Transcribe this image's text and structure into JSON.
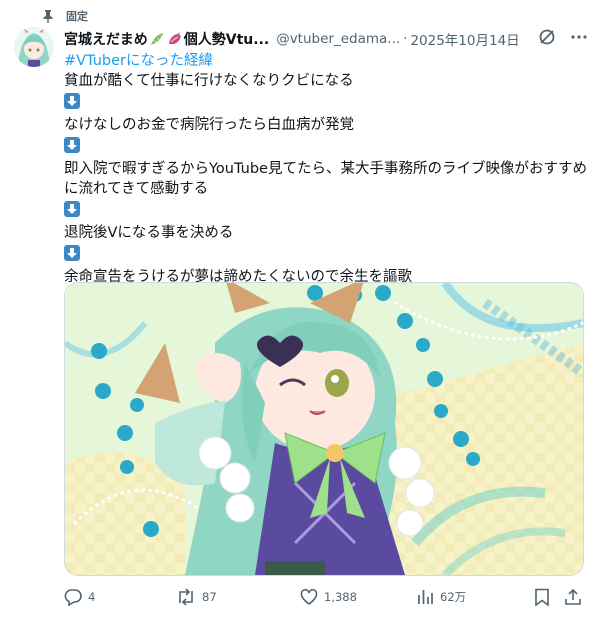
{
  "pinned": {
    "label": "固定",
    "icon": "pin-icon"
  },
  "author": {
    "display_name_prefix": "宮城えだまめ",
    "display_name_suffix": "個人勢Vtu...",
    "emojis": [
      "edamame-icon",
      "sweet-potato-icon"
    ],
    "handle": "@vtuber_edama...",
    "separator": "·",
    "date": "2025年10月14日",
    "avatar": "avatar"
  },
  "header_icons": [
    "grok-icon",
    "more-icon"
  ],
  "post": {
    "hashtag": "#VTuberになった経緯",
    "line1": "貧血が酷くて仕事に行けなくなりクビになる",
    "line2": "なけなしのお金で病院行ったら白血病が発覚",
    "line3": "即入院で暇すぎるからYouTube見てたら、某大手事務所のライブ映像がおすすめに流れてきて感動する",
    "line4": "退院後Vになる事を決める",
    "line5": "余命宣告をうけるが夢は諦めたくないので余生を謳歌",
    "arrow_icon": "down-arrow-icon"
  },
  "media": {
    "alt": "illustration",
    "colors": {
      "bg": "#e6f6d8",
      "hair": "#8fd7c4",
      "dress": "#5a4aa0",
      "ribbon": "#9fe08a",
      "dots": "#2aa9c8"
    }
  },
  "actions": {
    "reply_count": "4",
    "repost_count": "87",
    "like_count": "1,388",
    "views_count": "62万"
  },
  "colors": {
    "accent": "#1d9bf0",
    "muted": "#536471",
    "text": "#0f1419"
  }
}
